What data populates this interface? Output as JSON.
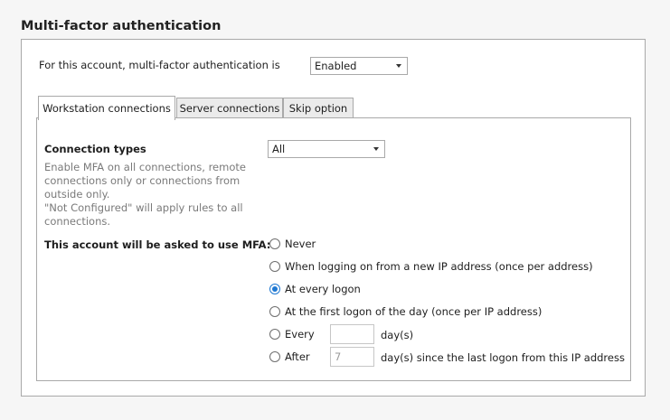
{
  "section": {
    "title": "Multi-factor authentication"
  },
  "account": {
    "label": "For this account, multi-factor authentication is",
    "status": "Enabled"
  },
  "tabs": [
    {
      "label": "Workstation connections",
      "active": true
    },
    {
      "label": "Server connections",
      "active": false
    },
    {
      "label": "Skip option",
      "active": false
    }
  ],
  "connection_types": {
    "title": "Connection types",
    "help_lines": [
      "Enable MFA on all connections, remote",
      "connections only or connections from",
      "outside only.",
      "\"Not Configured\" will apply rules to all",
      "connections."
    ],
    "value": "All"
  },
  "mfa": {
    "label": "This account will be asked to use MFA:",
    "options": [
      {
        "label": "Never",
        "checked": false
      },
      {
        "label": "When logging on from a new IP address (once per address)",
        "checked": false
      },
      {
        "label": "At every logon",
        "checked": true
      },
      {
        "label": "At the first logon of the day (once per IP address)",
        "checked": false
      },
      {
        "label": "Every",
        "checked": false
      },
      {
        "label": "After",
        "checked": false
      }
    ],
    "every_value": "",
    "every_unit": "day(s)",
    "after_value": "7",
    "after_unit": "day(s) since the last logon from this IP address"
  },
  "colors": {
    "accent": "#1e78d2",
    "border": "#a9a9a9",
    "help_text": "#7a7a7a"
  }
}
